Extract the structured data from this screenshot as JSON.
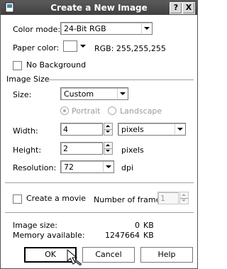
{
  "window": {
    "title": "Create a New Image"
  },
  "color_mode": {
    "label": "Color mode:",
    "value": "24-Bit RGB"
  },
  "paper_color": {
    "label": "Paper color:",
    "rgb_text": "RGB: 255,255,255",
    "swatch_color": "#ffffff"
  },
  "no_background": {
    "label": "No Background",
    "checked": false
  },
  "image_size": {
    "group_label": "Image Size",
    "size_label": "Size:",
    "size_value": "Custom",
    "portrait_label": "Portrait",
    "landscape_label": "Landscape",
    "width_label": "Width:",
    "width_value": "4",
    "width_unit": "pixels",
    "height_label": "Height:",
    "height_value": "2",
    "height_unit": "pixels",
    "resolution_label": "Resolution:",
    "resolution_value": "72",
    "resolution_unit": "dpi"
  },
  "movie": {
    "checkbox_label": "Create a movie",
    "frames_label": "Number of frames:",
    "frames_value": "1"
  },
  "info": {
    "size_label": "Image size:",
    "size_value": "0",
    "size_unit": "KB",
    "memory_label": "Memory available:",
    "memory_value": "1247664",
    "memory_unit": "KB"
  },
  "buttons": {
    "ok": "OK",
    "cancel": "Cancel",
    "help": "Help"
  },
  "title_buttons": {
    "help": "?",
    "close": "X"
  },
  "icons": {
    "app": "app-icon",
    "cursor": "mouse-cursor-icon"
  }
}
